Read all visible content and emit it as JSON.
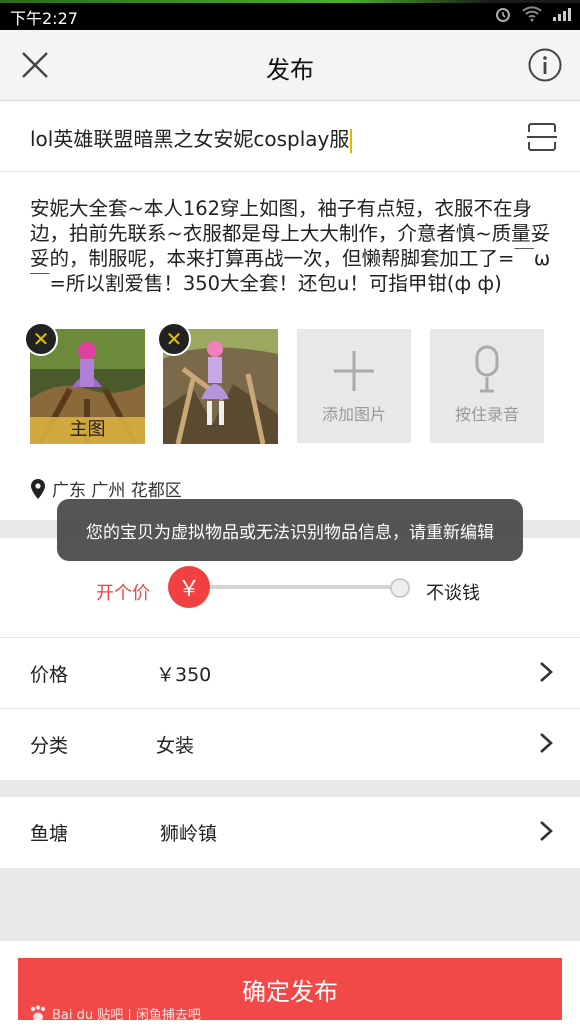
{
  "status_bar": {
    "time": "下午2:27"
  },
  "header": {
    "title": "发布"
  },
  "item": {
    "title": "lol英雄联盟暗黑之女安妮cosplay服",
    "description": "安妮大全套~本人162穿上如图，袖子有点短，衣服不在身边，拍前先联系~衣服都是母上大大制作，介意者慎~质量妥妥的，制服呢，本来打算再战一次，但懒帮脚套加工了=￣ω￣=所以割爱售！350大全套！还包u！可指甲钳(ф ф)"
  },
  "photos": {
    "main_label": "主图",
    "add_photo_label": "添加图片",
    "record_label": "按住录音"
  },
  "location": "广东 广州 花都区",
  "toast": "您的宝贝为虚拟物品或无法识别物品信息，请重新编辑",
  "price_slider": {
    "left_label": "开个价",
    "right_label": "不谈钱",
    "knob_symbol": "￥",
    "level": 0
  },
  "rows": [
    {
      "label": "价格",
      "value": "￥350"
    },
    {
      "label": "分类",
      "value": "女装"
    },
    {
      "label": "鱼塘",
      "value": "狮岭镇"
    }
  ],
  "submit_label": "确定发布",
  "watermark": "Bai du 贴吧 | 闲鱼捕去吧",
  "colors": {
    "accent": "#f24848",
    "toast_bg": "#464646",
    "caret": "#e8b400"
  }
}
